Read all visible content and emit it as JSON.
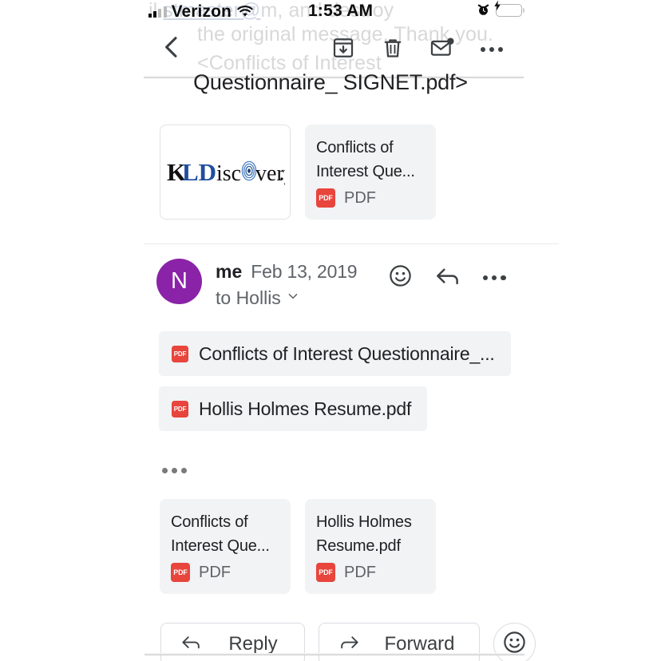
{
  "status_bar": {
    "carrier": "Verizon",
    "time": "1:53 AM",
    "signal_icon": "cellular-bars-icon",
    "wifi_icon": "wifi-icon",
    "alarm_icon": "alarm-clock-icon",
    "battery_icon": "battery-charging-icon"
  },
  "ghost_text": {
    "line1_pre": "il ",
    "line1_link": "stmaster@",
    "line1_post": "m, and destroy",
    "line2": "the original message. Thank you.",
    "line3": "<Conflicts of Interest"
  },
  "nav": {
    "back_icon": "back-chevron-icon",
    "archive_icon": "archive-icon",
    "delete_icon": "trash-icon",
    "unread_icon": "mark-unread-envelope-icon",
    "more_icon": "more-options-icon"
  },
  "subject_overflow": "Questionnaire_ SIGNET.pdf>",
  "top_attachments": [
    {
      "kind": "image",
      "logo_text_1": "K",
      "logo_text_2": "LD",
      "logo_text_3": "isc",
      "logo_text_4": "very",
      "logo_alt": "KLDiscovery logo"
    },
    {
      "kind": "file",
      "name": "Conflicts of Interest Que...",
      "type": "PDF",
      "badge": "PDF"
    }
  ],
  "sender": {
    "avatar_initial": "N",
    "avatar_color": "#8a23a8",
    "name": "me",
    "date": "Feb 13, 2019",
    "recipient": "to Hollis",
    "expand_icon": "chevron-down-icon",
    "emoji_icon": "emoji-smiley-icon",
    "reply_icon": "reply-arrow-icon",
    "more_icon": "more-options-icon"
  },
  "inline_attachments": [
    {
      "badge": "PDF",
      "name": "Conflicts of Interest Questionnaire_..."
    },
    {
      "badge": "PDF",
      "name": "Hollis Holmes Resume.pdf"
    }
  ],
  "expand_trimmed_icon": "expand-trimmed-content-icon",
  "bottom_attachments": [
    {
      "name": "Conflicts of Interest Que...",
      "type": "PDF",
      "badge": "PDF"
    },
    {
      "name": "Hollis Holmes Resume.pdf",
      "type": "PDF",
      "badge": "PDF"
    }
  ],
  "footer": {
    "reply_label": "Reply",
    "reply_icon": "reply-arrow-icon",
    "forward_label": "Forward",
    "forward_icon": "forward-arrow-icon",
    "emoji_icon": "emoji-smiley-icon"
  },
  "colors": {
    "accent_purple": "#8a23a8",
    "pdf_red": "#e8453c",
    "chip_gray": "#f1f3f4",
    "text_primary": "#202124",
    "text_secondary": "#5f6368"
  }
}
